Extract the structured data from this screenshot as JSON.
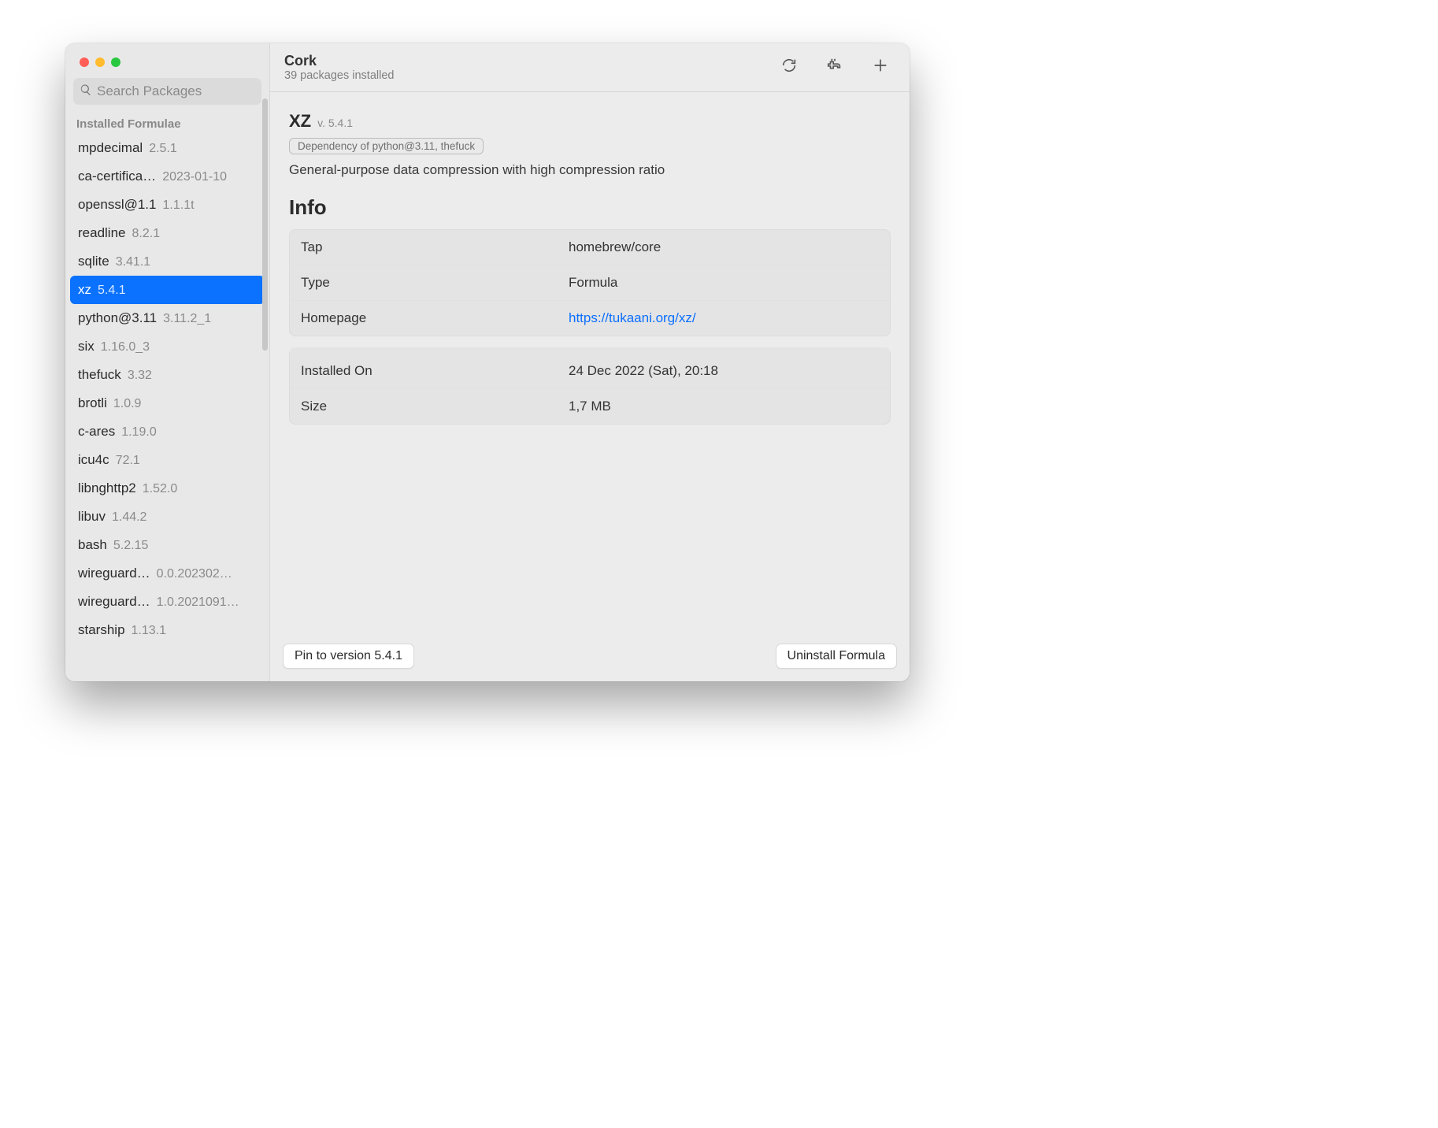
{
  "header": {
    "title": "Cork",
    "subtitle": "39 packages installed"
  },
  "search": {
    "placeholder": "Search Packages"
  },
  "sidebar": {
    "section": "Installed Formulae",
    "items": [
      {
        "name": "mpdecimal",
        "version": "2.5.1",
        "selected": false
      },
      {
        "name": "ca-certifica…",
        "version": "2023-01-10",
        "selected": false
      },
      {
        "name": "openssl@1.1",
        "version": "1.1.1t",
        "selected": false
      },
      {
        "name": "readline",
        "version": "8.2.1",
        "selected": false
      },
      {
        "name": "sqlite",
        "version": "3.41.1",
        "selected": false
      },
      {
        "name": "xz",
        "version": "5.4.1",
        "selected": true
      },
      {
        "name": "python@3.11",
        "version": "3.11.2_1",
        "selected": false
      },
      {
        "name": "six",
        "version": "1.16.0_3",
        "selected": false
      },
      {
        "name": "thefuck",
        "version": "3.32",
        "selected": false
      },
      {
        "name": "brotli",
        "version": "1.0.9",
        "selected": false
      },
      {
        "name": "c-ares",
        "version": "1.19.0",
        "selected": false
      },
      {
        "name": "icu4c",
        "version": "72.1",
        "selected": false
      },
      {
        "name": "libnghttp2",
        "version": "1.52.0",
        "selected": false
      },
      {
        "name": "libuv",
        "version": "1.44.2",
        "selected": false
      },
      {
        "name": "bash",
        "version": "5.2.15",
        "selected": false
      },
      {
        "name": "wireguard…",
        "version": "0.0.202302…",
        "selected": false
      },
      {
        "name": "wireguard…",
        "version": "1.0.2021091…",
        "selected": false
      },
      {
        "name": "starship",
        "version": "1.13.1",
        "selected": false
      }
    ]
  },
  "detail": {
    "name": "XZ",
    "version_label": "v. 5.4.1",
    "badge": "Dependency of python@3.11, thefuck",
    "description": "General-purpose data compression with high compression ratio",
    "info_heading": "Info",
    "groups": [
      [
        {
          "key": "Tap",
          "val": "homebrew/core",
          "link": false
        },
        {
          "key": "Type",
          "val": "Formula",
          "link": false
        },
        {
          "key": "Homepage",
          "val": "https://tukaani.org/xz/",
          "link": true
        }
      ],
      [
        {
          "key": "Installed On",
          "val": "24 Dec 2022 (Sat), 20:18",
          "link": false
        },
        {
          "key": "Size",
          "val": "1,7 MB",
          "link": false
        }
      ]
    ]
  },
  "footer": {
    "pin": "Pin to version 5.4.1",
    "uninstall": "Uninstall Formula"
  }
}
